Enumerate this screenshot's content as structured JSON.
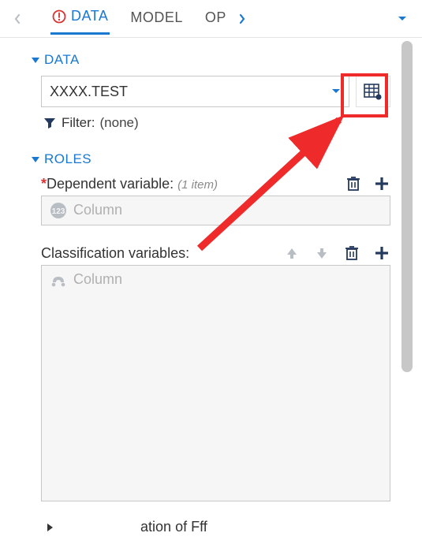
{
  "tabs": {
    "items": [
      {
        "label": "DATA",
        "active": true,
        "warn": true
      },
      {
        "label": "MODEL",
        "active": false
      },
      {
        "label": "OP",
        "active": false,
        "truncated": true
      }
    ]
  },
  "data_section": {
    "title": "DATA",
    "selected_table": "XXXX.TEST",
    "filter_label": "Filter:",
    "filter_value": "(none)"
  },
  "roles_section": {
    "title": "ROLES",
    "dependent": {
      "label": "Dependent variable:",
      "count_text": "(1 item)",
      "placeholder": "Column"
    },
    "classification": {
      "label": "Classification variables:",
      "placeholder": "Column"
    }
  },
  "bottom": {
    "text_fragment": "ation of Fff"
  }
}
